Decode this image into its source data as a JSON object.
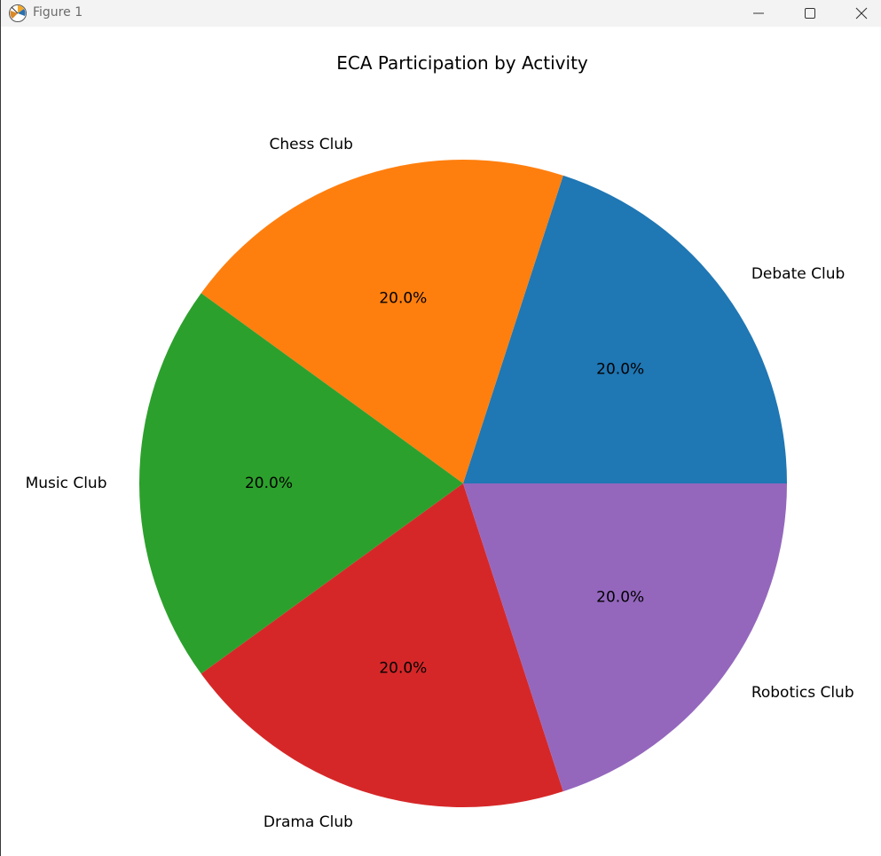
{
  "window": {
    "title": "Figure 1"
  },
  "colors": {
    "slices": [
      "#1f77b4",
      "#ff7f0e",
      "#2ca02c",
      "#d62728",
      "#9467bd"
    ],
    "titlebar": "#f3f3f3"
  },
  "icons": {
    "app": "matplotlib-figure-icon",
    "minimize": "minimize-icon",
    "maximize": "maximize-icon",
    "close": "close-icon"
  },
  "chart_data": {
    "type": "pie",
    "title": "ECA Participation by Activity",
    "categories": [
      "Debate Club",
      "Chess Club",
      "Music Club",
      "Drama Club",
      "Robotics Club"
    ],
    "values": [
      20,
      20,
      20,
      20,
      20
    ],
    "percent_labels": [
      "20.0%",
      "20.0%",
      "20.0%",
      "20.0%",
      "20.0%"
    ],
    "start_angle_deg": 0,
    "direction": "counterclockwise"
  }
}
